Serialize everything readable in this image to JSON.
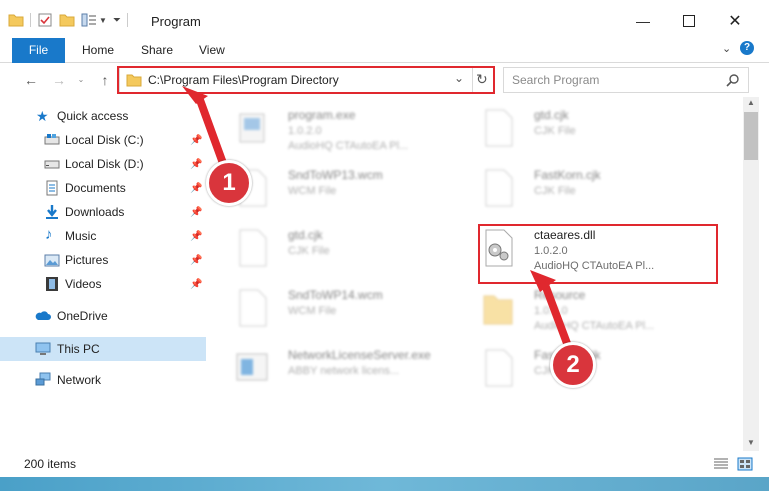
{
  "window": {
    "title": "Program",
    "controls": [
      "minimize",
      "maximize",
      "close"
    ]
  },
  "ribbon": {
    "tabs": [
      "File",
      "Home",
      "Share",
      "View"
    ]
  },
  "address_bar": {
    "path": "C:\\Program Files\\Program Directory",
    "icon": "folder-icon"
  },
  "search": {
    "placeholder": "Search Program"
  },
  "nav_pane": {
    "quick_access": "Quick access",
    "items": [
      {
        "label": "Local Disk (C:)",
        "icon": "drive-icon",
        "pinned": true
      },
      {
        "label": "Local Disk (D:)",
        "icon": "drive-icon",
        "pinned": true
      },
      {
        "label": "Documents",
        "icon": "documents-icon",
        "pinned": true
      },
      {
        "label": "Downloads",
        "icon": "downloads-icon",
        "pinned": true
      },
      {
        "label": "Music",
        "icon": "music-icon",
        "pinned": true
      },
      {
        "label": "Pictures",
        "icon": "pictures-icon",
        "pinned": true
      },
      {
        "label": "Videos",
        "icon": "videos-icon",
        "pinned": true
      }
    ],
    "onedrive": "OneDrive",
    "this_pc": "This PC",
    "network": "Network"
  },
  "files": [
    {
      "name": "program.exe",
      "line2": "1.0.2.0",
      "line3": "AudioHQ CTAutoEA Pl...",
      "icon": "exe-icon"
    },
    {
      "name": "gtd.cjk",
      "line2": "CJK File",
      "line3": "",
      "icon": "file-icon"
    },
    {
      "name": "SndToWP13.wcm",
      "line2": "WCM File",
      "line3": "",
      "icon": "file-icon"
    },
    {
      "name": "FastKorn.cjk",
      "line2": "CJK File",
      "line3": "",
      "icon": "file-icon"
    },
    {
      "name": "gtd.cjk",
      "line2": "CJK File",
      "line3": "",
      "icon": "file-icon"
    },
    {
      "name": "ctaeares.dll",
      "line2": "1.0.2.0",
      "line3": "AudioHQ CTAutoEA Pl...",
      "icon": "dll-icon"
    },
    {
      "name": "SndToWP14.wcm",
      "line2": "WCM File",
      "line3": "",
      "icon": "file-icon"
    },
    {
      "name": "Resource",
      "line2": "1.0.2.0",
      "line3": "AudioHQ CTAutoEA Pl...",
      "icon": "folder-icon"
    },
    {
      "name": "NetworkLicenseServer.exe",
      "line2": "ABBY network licens...",
      "line3": "",
      "icon": "window-icon"
    },
    {
      "name": "FastKorn.cjk",
      "line2": "CJK File",
      "line3": "",
      "icon": "file-icon"
    }
  ],
  "status": {
    "items_count": "200 items"
  },
  "annotations": {
    "step1": "1",
    "step2": "2",
    "highlight_color": "#e0282e",
    "badge_color": "#d9353c"
  },
  "colors": {
    "file_tab": "#1979ca",
    "selected_nav": "#cce4f7"
  }
}
